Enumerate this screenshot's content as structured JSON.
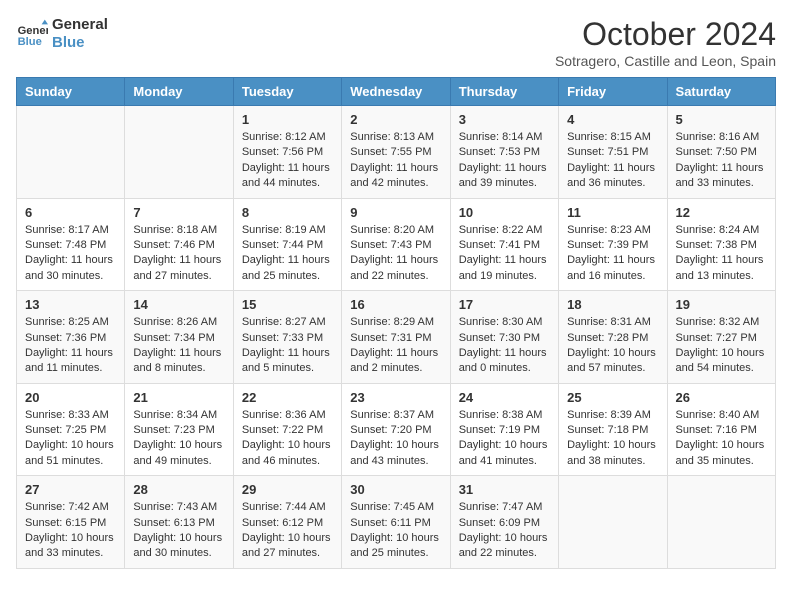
{
  "header": {
    "logo_line1": "General",
    "logo_line2": "Blue",
    "month_year": "October 2024",
    "location": "Sotragero, Castille and Leon, Spain"
  },
  "days_of_week": [
    "Sunday",
    "Monday",
    "Tuesday",
    "Wednesday",
    "Thursday",
    "Friday",
    "Saturday"
  ],
  "weeks": [
    [
      {
        "day": "",
        "sunrise": "",
        "sunset": "",
        "daylight": ""
      },
      {
        "day": "",
        "sunrise": "",
        "sunset": "",
        "daylight": ""
      },
      {
        "day": "1",
        "sunrise": "Sunrise: 8:12 AM",
        "sunset": "Sunset: 7:56 PM",
        "daylight": "Daylight: 11 hours and 44 minutes."
      },
      {
        "day": "2",
        "sunrise": "Sunrise: 8:13 AM",
        "sunset": "Sunset: 7:55 PM",
        "daylight": "Daylight: 11 hours and 42 minutes."
      },
      {
        "day": "3",
        "sunrise": "Sunrise: 8:14 AM",
        "sunset": "Sunset: 7:53 PM",
        "daylight": "Daylight: 11 hours and 39 minutes."
      },
      {
        "day": "4",
        "sunrise": "Sunrise: 8:15 AM",
        "sunset": "Sunset: 7:51 PM",
        "daylight": "Daylight: 11 hours and 36 minutes."
      },
      {
        "day": "5",
        "sunrise": "Sunrise: 8:16 AM",
        "sunset": "Sunset: 7:50 PM",
        "daylight": "Daylight: 11 hours and 33 minutes."
      }
    ],
    [
      {
        "day": "6",
        "sunrise": "Sunrise: 8:17 AM",
        "sunset": "Sunset: 7:48 PM",
        "daylight": "Daylight: 11 hours and 30 minutes."
      },
      {
        "day": "7",
        "sunrise": "Sunrise: 8:18 AM",
        "sunset": "Sunset: 7:46 PM",
        "daylight": "Daylight: 11 hours and 27 minutes."
      },
      {
        "day": "8",
        "sunrise": "Sunrise: 8:19 AM",
        "sunset": "Sunset: 7:44 PM",
        "daylight": "Daylight: 11 hours and 25 minutes."
      },
      {
        "day": "9",
        "sunrise": "Sunrise: 8:20 AM",
        "sunset": "Sunset: 7:43 PM",
        "daylight": "Daylight: 11 hours and 22 minutes."
      },
      {
        "day": "10",
        "sunrise": "Sunrise: 8:22 AM",
        "sunset": "Sunset: 7:41 PM",
        "daylight": "Daylight: 11 hours and 19 minutes."
      },
      {
        "day": "11",
        "sunrise": "Sunrise: 8:23 AM",
        "sunset": "Sunset: 7:39 PM",
        "daylight": "Daylight: 11 hours and 16 minutes."
      },
      {
        "day": "12",
        "sunrise": "Sunrise: 8:24 AM",
        "sunset": "Sunset: 7:38 PM",
        "daylight": "Daylight: 11 hours and 13 minutes."
      }
    ],
    [
      {
        "day": "13",
        "sunrise": "Sunrise: 8:25 AM",
        "sunset": "Sunset: 7:36 PM",
        "daylight": "Daylight: 11 hours and 11 minutes."
      },
      {
        "day": "14",
        "sunrise": "Sunrise: 8:26 AM",
        "sunset": "Sunset: 7:34 PM",
        "daylight": "Daylight: 11 hours and 8 minutes."
      },
      {
        "day": "15",
        "sunrise": "Sunrise: 8:27 AM",
        "sunset": "Sunset: 7:33 PM",
        "daylight": "Daylight: 11 hours and 5 minutes."
      },
      {
        "day": "16",
        "sunrise": "Sunrise: 8:29 AM",
        "sunset": "Sunset: 7:31 PM",
        "daylight": "Daylight: 11 hours and 2 minutes."
      },
      {
        "day": "17",
        "sunrise": "Sunrise: 8:30 AM",
        "sunset": "Sunset: 7:30 PM",
        "daylight": "Daylight: 11 hours and 0 minutes."
      },
      {
        "day": "18",
        "sunrise": "Sunrise: 8:31 AM",
        "sunset": "Sunset: 7:28 PM",
        "daylight": "Daylight: 10 hours and 57 minutes."
      },
      {
        "day": "19",
        "sunrise": "Sunrise: 8:32 AM",
        "sunset": "Sunset: 7:27 PM",
        "daylight": "Daylight: 10 hours and 54 minutes."
      }
    ],
    [
      {
        "day": "20",
        "sunrise": "Sunrise: 8:33 AM",
        "sunset": "Sunset: 7:25 PM",
        "daylight": "Daylight: 10 hours and 51 minutes."
      },
      {
        "day": "21",
        "sunrise": "Sunrise: 8:34 AM",
        "sunset": "Sunset: 7:23 PM",
        "daylight": "Daylight: 10 hours and 49 minutes."
      },
      {
        "day": "22",
        "sunrise": "Sunrise: 8:36 AM",
        "sunset": "Sunset: 7:22 PM",
        "daylight": "Daylight: 10 hours and 46 minutes."
      },
      {
        "day": "23",
        "sunrise": "Sunrise: 8:37 AM",
        "sunset": "Sunset: 7:20 PM",
        "daylight": "Daylight: 10 hours and 43 minutes."
      },
      {
        "day": "24",
        "sunrise": "Sunrise: 8:38 AM",
        "sunset": "Sunset: 7:19 PM",
        "daylight": "Daylight: 10 hours and 41 minutes."
      },
      {
        "day": "25",
        "sunrise": "Sunrise: 8:39 AM",
        "sunset": "Sunset: 7:18 PM",
        "daylight": "Daylight: 10 hours and 38 minutes."
      },
      {
        "day": "26",
        "sunrise": "Sunrise: 8:40 AM",
        "sunset": "Sunset: 7:16 PM",
        "daylight": "Daylight: 10 hours and 35 minutes."
      }
    ],
    [
      {
        "day": "27",
        "sunrise": "Sunrise: 7:42 AM",
        "sunset": "Sunset: 6:15 PM",
        "daylight": "Daylight: 10 hours and 33 minutes."
      },
      {
        "day": "28",
        "sunrise": "Sunrise: 7:43 AM",
        "sunset": "Sunset: 6:13 PM",
        "daylight": "Daylight: 10 hours and 30 minutes."
      },
      {
        "day": "29",
        "sunrise": "Sunrise: 7:44 AM",
        "sunset": "Sunset: 6:12 PM",
        "daylight": "Daylight: 10 hours and 27 minutes."
      },
      {
        "day": "30",
        "sunrise": "Sunrise: 7:45 AM",
        "sunset": "Sunset: 6:11 PM",
        "daylight": "Daylight: 10 hours and 25 minutes."
      },
      {
        "day": "31",
        "sunrise": "Sunrise: 7:47 AM",
        "sunset": "Sunset: 6:09 PM",
        "daylight": "Daylight: 10 hours and 22 minutes."
      },
      {
        "day": "",
        "sunrise": "",
        "sunset": "",
        "daylight": ""
      },
      {
        "day": "",
        "sunrise": "",
        "sunset": "",
        "daylight": ""
      }
    ]
  ]
}
